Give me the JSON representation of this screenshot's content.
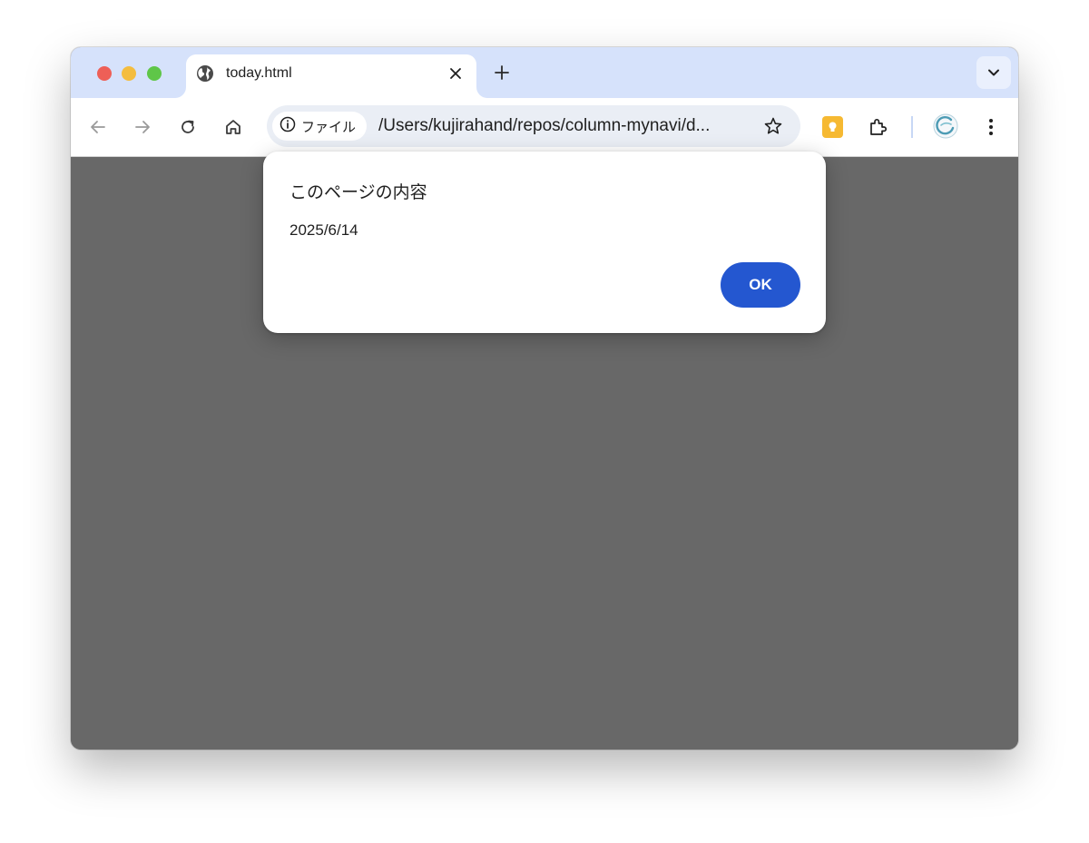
{
  "tab": {
    "title": "today.html",
    "favicon_icon": "globe-icon",
    "close_icon": "close-icon"
  },
  "tabstrip": {
    "new_tab_icon": "plus-icon",
    "tab_search_icon": "chevron-down-icon"
  },
  "toolbar": {
    "back_icon": "back-arrow-icon",
    "forward_icon": "forward-arrow-icon",
    "reload_icon": "reload-icon",
    "home_icon": "home-icon",
    "site_info_label": "ファイル",
    "url": "/Users/kujirahand/repos/column-mynavi/d...",
    "bookmark_icon": "star-icon",
    "extension_keep_icon": "keep-notes-icon",
    "extensions_icon": "puzzle-piece-icon",
    "profile_icon": "profile-avatar-icon",
    "menu_icon": "kebab-menu-icon"
  },
  "dialog": {
    "title": "このページの内容",
    "message": "2025/6/14",
    "ok_label": "OK"
  },
  "colors": {
    "tabstrip_bg": "#d6e2fb",
    "omnibox_bg": "#eaeef5",
    "content_bg": "#686868",
    "ok_button_bg": "#2457d0",
    "traffic_red": "#ee5f57",
    "traffic_yellow": "#f4bd3f",
    "traffic_green": "#5fc648"
  }
}
